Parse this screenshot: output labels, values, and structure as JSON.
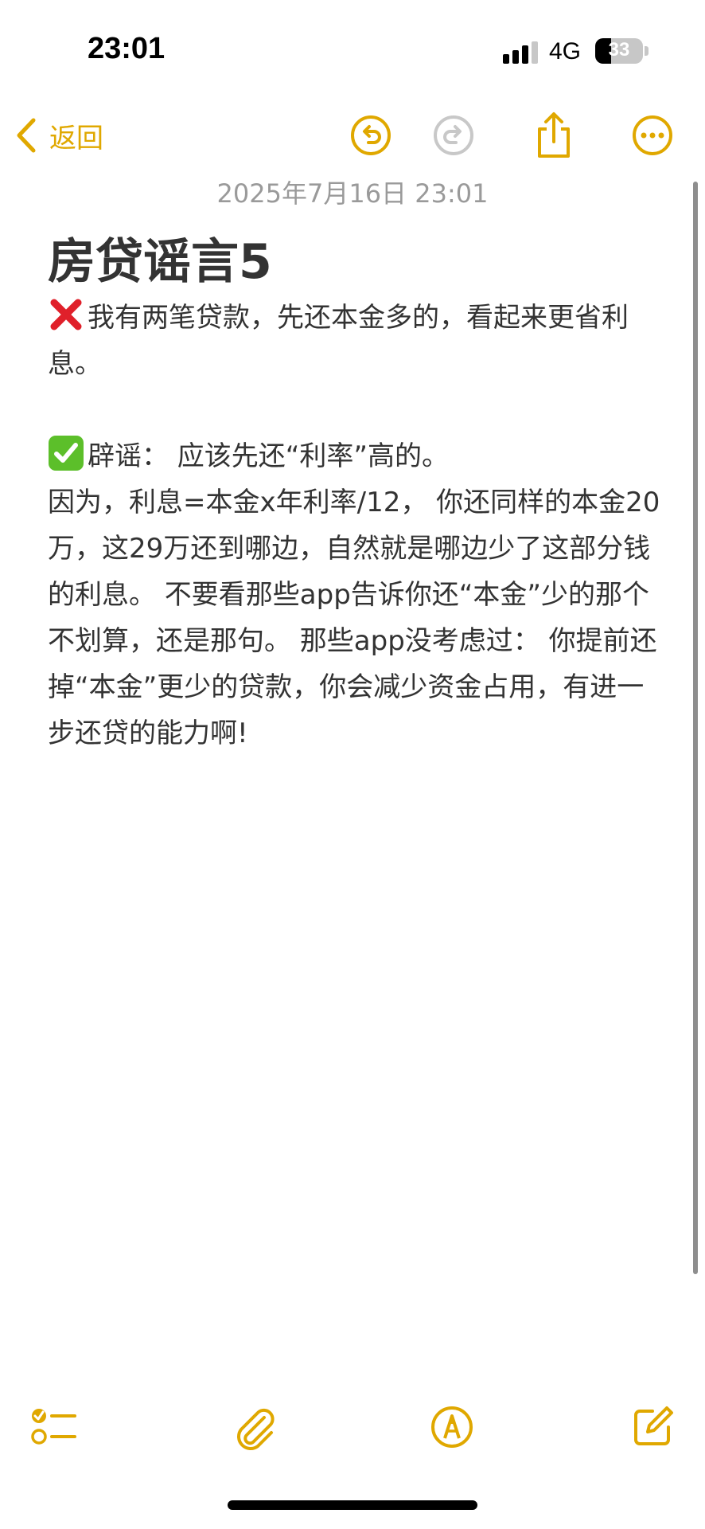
{
  "status_bar": {
    "time": "23:01",
    "network": "4G",
    "battery_level": "33",
    "battery_fraction": 0.33
  },
  "toolbar": {
    "back_label": "返回",
    "icons": {
      "back": "chevron-left-icon",
      "undo": "undo-icon",
      "redo": "redo-icon",
      "share": "share-icon",
      "more": "ellipsis-circle-icon"
    },
    "redo_enabled": false
  },
  "note": {
    "date": "2025年7月16日 23:01",
    "title": "房贷谣言5",
    "paragraphs": [
      {
        "icon": "cross-mark-emoji",
        "text": "我有两笔贷款，先还本金多的，看起来更省利息。"
      },
      {
        "icon": "check-mark-emoji",
        "text": "辟谣： 应该先还“利率”高的。"
      },
      {
        "icon": "",
        "text": "因为，利息=本金x年利率/12， 你还同样的本金20万，这29万还到哪边，自然就是哪边少了这部分钱的利息。 不要看那些app告诉你还“本金”少的那个不划算，还是那句。 那些app没考虑过： 你提前还掉“本金”更少的贷款，你会减少资金占用，有进一步还贷的能力啊!"
      }
    ]
  },
  "bottom_toolbar": {
    "icons": {
      "checklist": "checklist-icon",
      "attachment": "paperclip-icon",
      "markup": "markup-pen-icon",
      "compose": "compose-icon"
    }
  },
  "colors": {
    "accent": "#E0A800",
    "text": "#333333",
    "date": "#9a9a9a",
    "disabled": "#c8c8c8",
    "cross": "#e0202a",
    "check": "#5cbf2a"
  }
}
